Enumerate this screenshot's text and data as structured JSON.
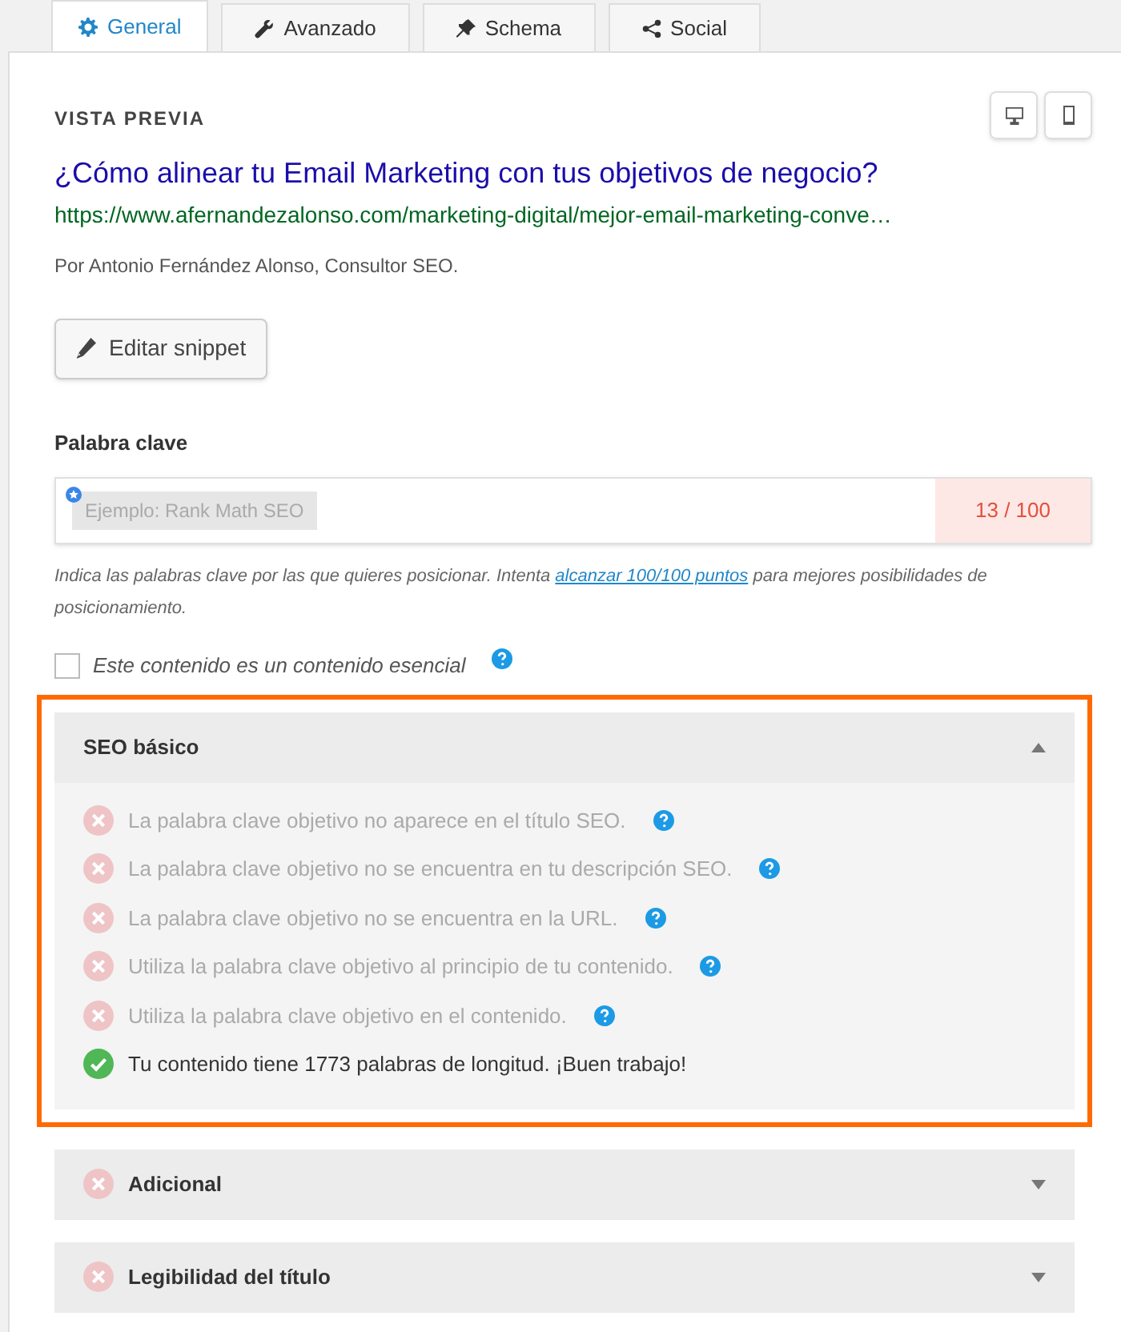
{
  "tabs": [
    {
      "label": "General",
      "selected": true
    },
    {
      "label": "Avanzado",
      "selected": false
    },
    {
      "label": "Schema",
      "selected": false
    },
    {
      "label": "Social",
      "selected": false
    }
  ],
  "preview": {
    "heading": "VISTA PREVIA",
    "title": "¿Cómo alinear tu Email Marketing con tus objetivos de negocio?",
    "url": "https://www.afernandezalonso.com/marketing-digital/mejor-email-marketing-conve…",
    "description": "Por Antonio Fernández Alonso, Consultor SEO.",
    "edit_button": "Editar snippet"
  },
  "keyword": {
    "label": "Palabra clave",
    "placeholder": "Ejemplo: Rank Math SEO",
    "score": "13 / 100",
    "help_before": "Indica las palabras clave por las que quieres posicionar. Intenta ",
    "help_link": "alcanzar 100/100 puntos",
    "help_after": " para mejores posibilidades de posicionamiento."
  },
  "pillar": {
    "label": "Este contenido es un contenido esencial",
    "checked": false
  },
  "sections": [
    {
      "title": "SEO básico",
      "expanded": true,
      "highlighted": true,
      "checks": [
        {
          "text": "La palabra clave objetivo no aparece en el título SEO.",
          "passed": false,
          "help": true
        },
        {
          "text": "La palabra clave objetivo no se encuentra en tu descripción SEO.",
          "passed": false,
          "help": true
        },
        {
          "text": "La palabra clave objetivo no se encuentra en la URL.",
          "passed": false,
          "help": true
        },
        {
          "text": "Utiliza la palabra clave objetivo al principio de tu contenido.",
          "passed": false,
          "help": true
        },
        {
          "text": "Utiliza la palabra clave objetivo en el contenido.",
          "passed": false,
          "help": true
        },
        {
          "text": "Tu contenido tiene 1773 palabras de longitud. ¡Buen trabajo!",
          "passed": true,
          "help": false
        }
      ]
    },
    {
      "title": "Adicional",
      "expanded": false,
      "highlighted": false,
      "passed": false
    },
    {
      "title": "Legibilidad del título",
      "expanded": false,
      "highlighted": false,
      "passed": false
    }
  ]
}
